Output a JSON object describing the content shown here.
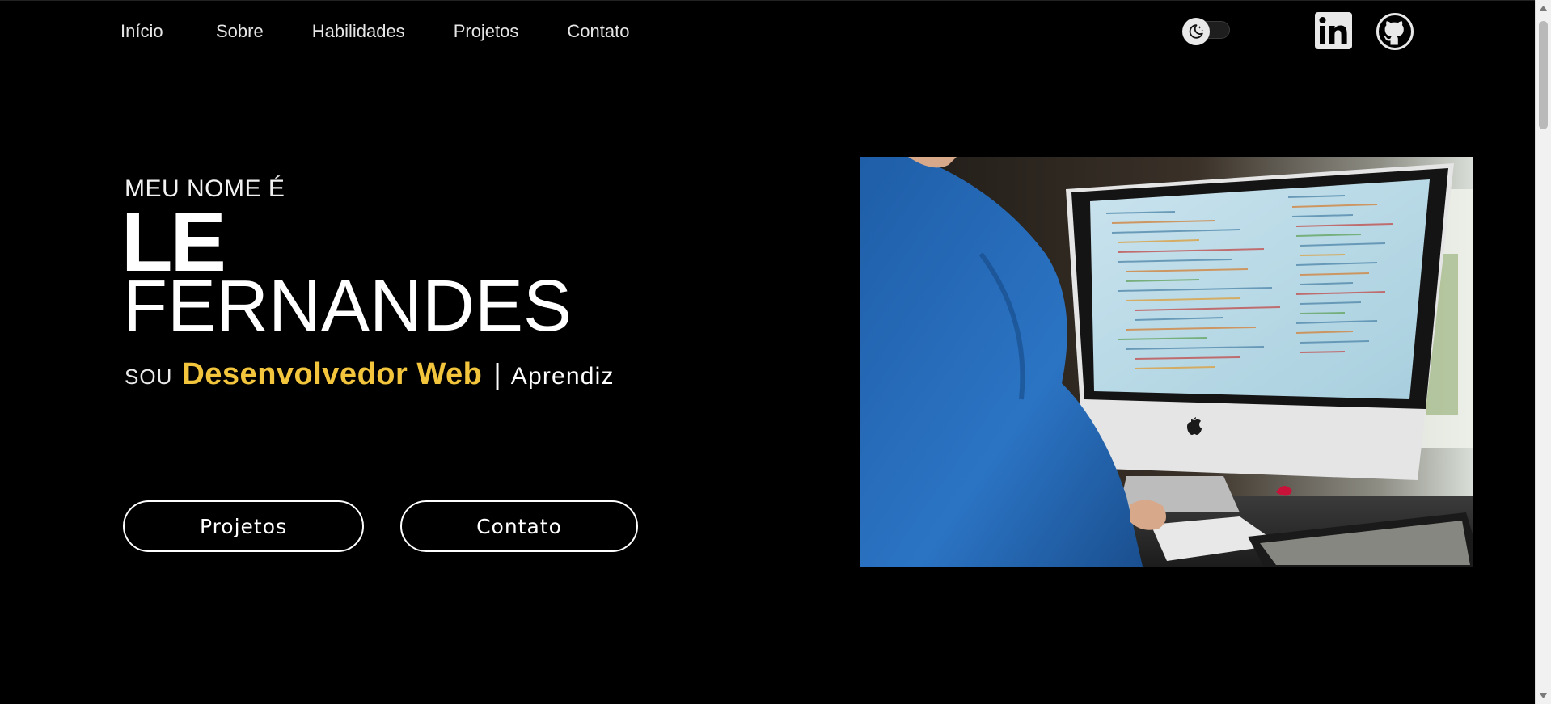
{
  "nav": {
    "items": [
      {
        "label": "Início"
      },
      {
        "label": "Sobre"
      },
      {
        "label": "Habilidades"
      },
      {
        "label": "Projetos"
      },
      {
        "label": "Contato"
      }
    ]
  },
  "header": {
    "theme_toggle_icon": "moon-stars-icon",
    "social": [
      {
        "icon": "linkedin-icon"
      },
      {
        "icon": "github-icon"
      }
    ]
  },
  "hero": {
    "intro": "MEU NOME É",
    "first_name": "LE",
    "last_name": "FERNANDES",
    "role_prefix": "SOU",
    "role_main": "Desenvolvedor Web",
    "role_separator": "|",
    "role_alt": "Aprendiz",
    "buttons": {
      "projects": "Projetos",
      "contact": "Contato"
    },
    "image_icon": "developer-at-imac-photo"
  },
  "colors": {
    "background": "#000000",
    "accent": "#f2c53d",
    "text": "#ffffff"
  }
}
